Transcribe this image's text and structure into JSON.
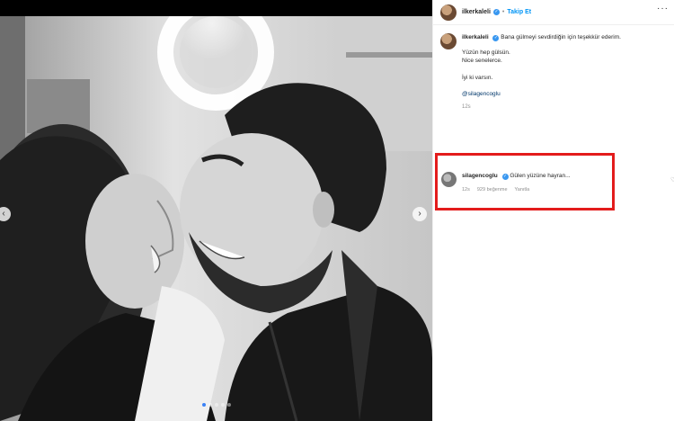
{
  "post": {
    "author": "ilkerkaleli",
    "follow_label": "Takip Et",
    "separator": "•",
    "more": "···"
  },
  "caption": {
    "username": "ilkerkaleli",
    "lines": [
      "Bana gülmeyi sevdirdiğin için teşekkür ederim.",
      "Yüzün hep gülsün.",
      "Nice senelerce.",
      "İyi ki varsın.",
      "@silagencoglu"
    ],
    "time": "12s"
  },
  "comment": {
    "username": "silagencoglu",
    "text": "Gülen yüzüne hayran...",
    "time": "12s",
    "likes": "929 beğenme",
    "reply": "Yanıtla"
  },
  "carousel": {
    "prev_icon": "‹",
    "next_icon": "›",
    "dot_count": 5,
    "active_index": 0
  },
  "colors": {
    "highlight": "#e31c1c",
    "verified": "#3897f0",
    "follow": "#0095f6"
  }
}
